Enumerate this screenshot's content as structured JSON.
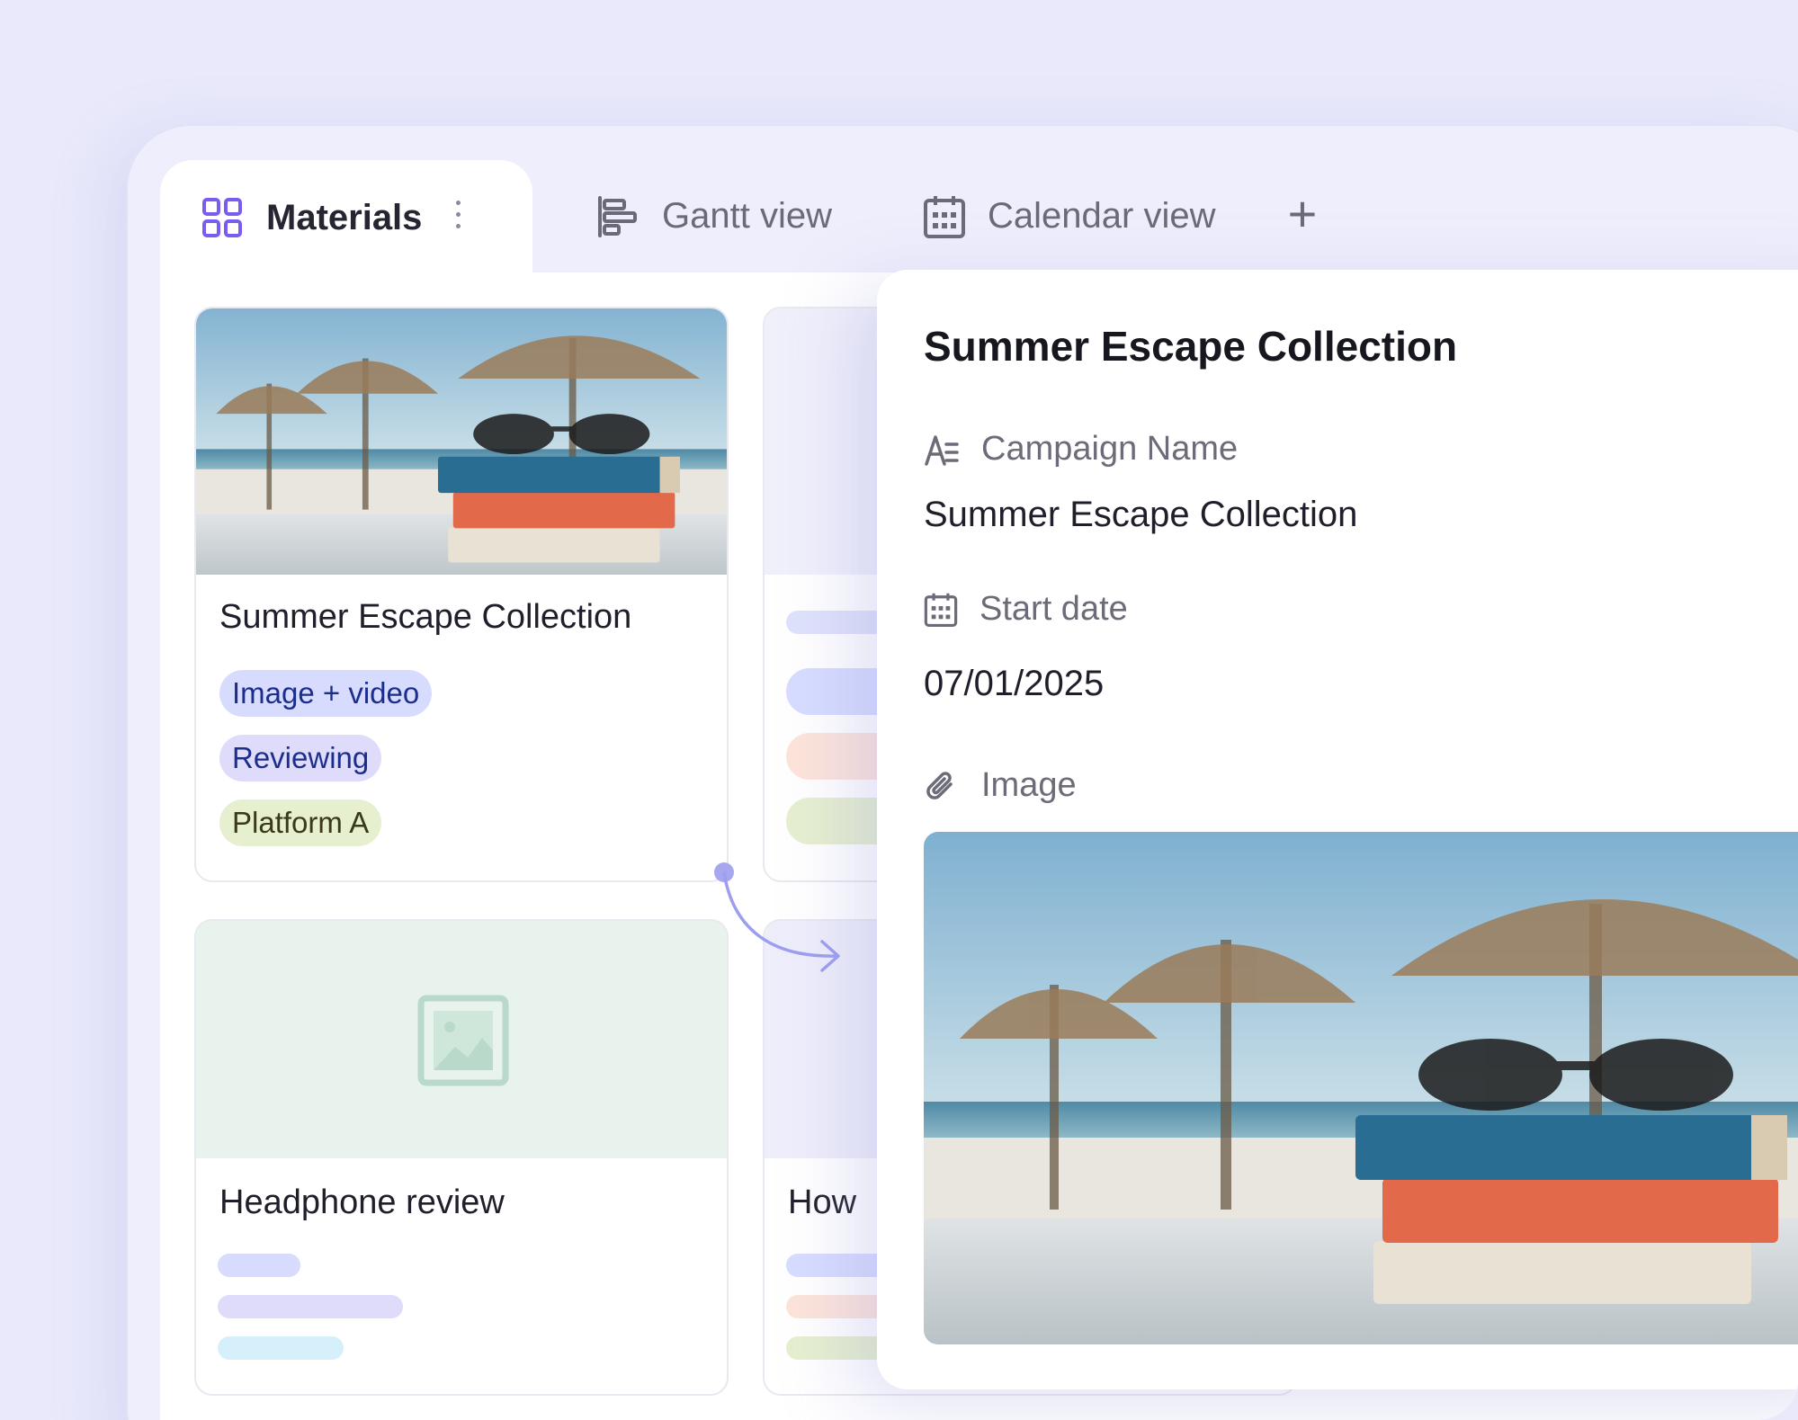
{
  "tabs": {
    "active": {
      "label": "Materials",
      "icon": "grid-icon"
    },
    "gantt": {
      "label": "Gantt view",
      "icon": "gantt-icon"
    },
    "calendar": {
      "label": "Calendar view",
      "icon": "calendar-icon"
    },
    "add": {
      "label": "+"
    }
  },
  "cards": [
    {
      "title": "Summer Escape Collection",
      "tags": {
        "format": "Image + video",
        "status": "Reviewing",
        "platform": "Platform A"
      }
    },
    {
      "title": "Headphone review"
    },
    {
      "title": "How"
    }
  ],
  "panel": {
    "title": "Summer Escape Collection",
    "fields": {
      "campaign_label": "Campaign Name",
      "campaign_value": "Summer Escape Collection",
      "start_label": "Start date",
      "start_value": "07/01/2025",
      "image_label": "Image"
    }
  },
  "colors": {
    "accent": "#7b5cf0",
    "tag_format_bg": "#d7dcff",
    "tag_status_bg": "#dfdcfb",
    "tag_platform_bg": "#e6efcf",
    "background": "#e9e9fb"
  }
}
